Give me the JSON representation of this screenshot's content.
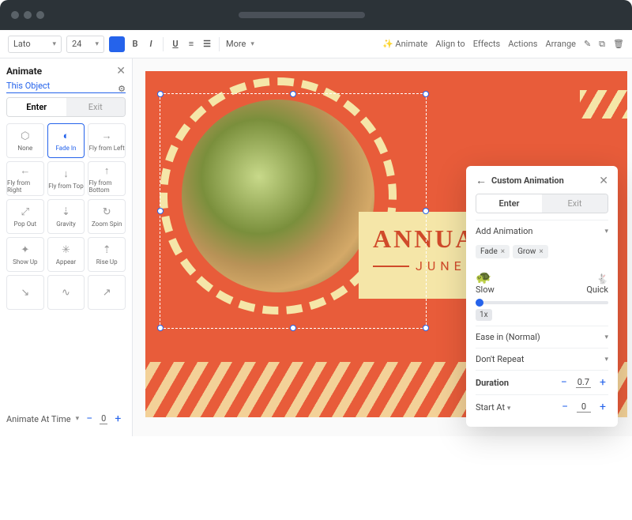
{
  "toolbar": {
    "font": "Lato",
    "size": "24",
    "more": "More",
    "right": {
      "animate": "Animate",
      "align": "Align to",
      "effects": "Effects",
      "actions": "Actions",
      "arrange": "Arrange"
    }
  },
  "sidebar": {
    "title": "Animate",
    "link": "This Object",
    "tabs": {
      "enter": "Enter",
      "exit": "Exit"
    },
    "anims": [
      "None",
      "Fade In",
      "Fly from Left",
      "Fly from Right",
      "Fly from Top",
      "Fly from Bottom",
      "Pop Out",
      "Gravity",
      "Zoom Spin",
      "Show Up",
      "Appear",
      "Rise Up"
    ],
    "timing_label": "Animate At Time",
    "timing_value": "0"
  },
  "canvas": {
    "title": "ANNUAL",
    "subtitle": "JUNE"
  },
  "panel": {
    "title": "Custom Animation",
    "tabs": {
      "enter": "Enter",
      "exit": "Exit"
    },
    "add_label": "Add Animation",
    "chips": [
      "Fade",
      "Grow"
    ],
    "speed": {
      "slow": "Slow",
      "quick": "Quick",
      "badge": "1x"
    },
    "easing": "Ease in (Normal)",
    "repeat": "Don't Repeat",
    "duration_label": "Duration",
    "duration_value": "0.7",
    "start_label": "Start At",
    "start_value": "0"
  }
}
